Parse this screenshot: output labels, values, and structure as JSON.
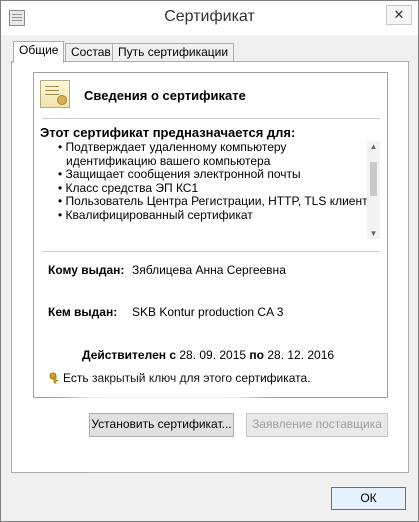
{
  "window": {
    "title": "Сертификат",
    "close_glyph": "✕"
  },
  "tabs": [
    {
      "label": "Общие"
    },
    {
      "label": "Состав"
    },
    {
      "label": "Путь сертификации"
    }
  ],
  "certificate": {
    "header_title": "Сведения о сертификате",
    "purpose_heading": "Этот сертификат предназначается для:",
    "purposes": [
      "• Подтверждает удаленному компьютеру",
      "идентификацию вашего компьютера",
      "• Защищает сообщения электронной почты",
      "• Класс средства ЭП КС1",
      "• Пользователь Центра Регистрации, HTTP, TLS клиент",
      "• Квалифицированный сертификат"
    ],
    "issued_to_label": "Кому выдан:",
    "issued_to_value": "Зяблицева Анна Сергеевна",
    "issued_by_label": "Кем выдан:",
    "issued_by_value": "SKB Kontur production CA 3",
    "valid_from_label": "Действителен с",
    "valid_from": "28. 09. 2015",
    "valid_to_label": "по",
    "valid_to": "28. 12. 2016",
    "private_key_note": "Есть закрытый ключ для этого сертификата."
  },
  "buttons": {
    "install": "Установить сертификат...",
    "issuer_statement": "Заявление поставщика",
    "ok": "ОК"
  },
  "icons": {
    "key": "key-icon",
    "certificate": "certificate-icon"
  },
  "colors": {
    "key": "#d9a520",
    "ok_border": "#3c7fb1"
  }
}
